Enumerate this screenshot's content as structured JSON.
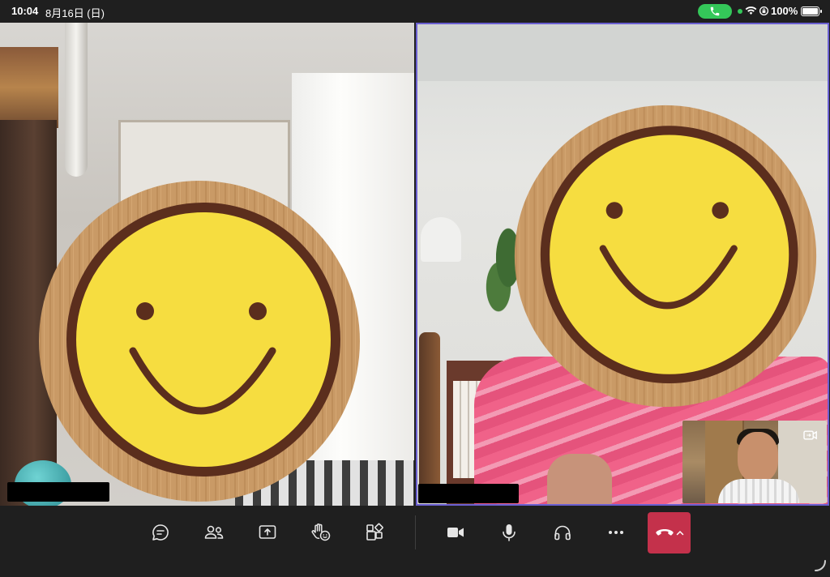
{
  "status_bar": {
    "time": "10:04",
    "date": "8月16日 (日)",
    "battery_percent": "100%",
    "call_indicator_icon": "phone-icon",
    "call_indicator_color": "#34c759"
  },
  "video_tiles": [
    {
      "id": "left",
      "active_speaker": false
    },
    {
      "id": "right",
      "active_speaker": true,
      "highlight_color": "#6a5fd1"
    }
  ],
  "toolbar": {
    "buttons": [
      {
        "name": "chat-button",
        "icon": "chat-icon"
      },
      {
        "name": "participants-button",
        "icon": "people-icon"
      },
      {
        "name": "share-button",
        "icon": "share-tray-icon"
      },
      {
        "name": "react-button",
        "icon": "raise-hand-icon"
      },
      {
        "name": "apps-button",
        "icon": "apps-icon"
      },
      {
        "name": "camera-button",
        "icon": "video-camera-icon"
      },
      {
        "name": "mic-button",
        "icon": "microphone-icon"
      },
      {
        "name": "audio-button",
        "icon": "headphones-icon"
      },
      {
        "name": "more-button",
        "icon": "more-dots-icon"
      }
    ],
    "hangup_color": "#c4314b"
  }
}
